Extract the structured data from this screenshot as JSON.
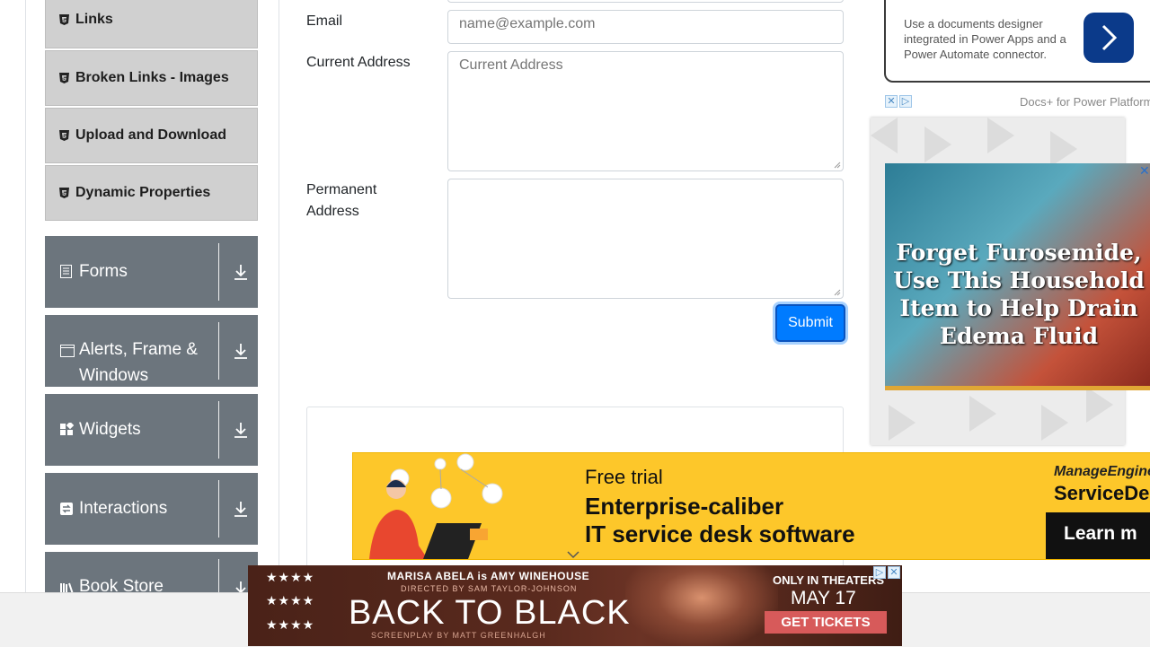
{
  "sidebar": {
    "elements_items": [
      {
        "label": "Links",
        "icon": "html5-icon"
      },
      {
        "label": "Broken Links - Images",
        "icon": "html5-icon"
      },
      {
        "label": "Upload and Download",
        "icon": "html5-icon"
      },
      {
        "label": "Dynamic Properties",
        "icon": "html5-icon"
      }
    ],
    "groups": [
      {
        "label": "Forms",
        "icon": "document-icon"
      },
      {
        "label": "Alerts, Frame & Windows",
        "icon": "window-icon"
      },
      {
        "label": "Widgets",
        "icon": "widgets-icon"
      },
      {
        "label": "Interactions",
        "icon": "interactions-icon"
      },
      {
        "label": "Book Store",
        "icon": "bookstore-icon"
      }
    ]
  },
  "form": {
    "email_label": "Email",
    "email_placeholder": "name@example.com",
    "email_value": "",
    "current_address_label": "Current Address",
    "current_address_placeholder": "Current Address",
    "permanent_address_label": "Permanent Address",
    "permanent_address_placeholder": "",
    "submit_label": "Submit"
  },
  "ads": {
    "docs_card_text": "Use a documents designer integrated in Power Apps and a Power Automate connector.",
    "docs_source": "Docs+ for Power Platform",
    "edema_headline": "Forget Furosemide, Use This Household Item to Help Drain Edema Fluid",
    "servicedesk": {
      "line1": "Free trial",
      "line2": "Enterprise-caliber",
      "line3": "IT service desk software",
      "brand1": "ManageEngine",
      "brand2": "ServiceDe",
      "cta": "Learn m"
    },
    "movie": {
      "stars": "★★★★",
      "cast": "MARISA ABELA is AMY WINEHOUSE",
      "director": "DIRECTED BY SAM TAYLOR-JOHNSON",
      "title": "BACK TO BLACK",
      "screenplay": "SCREENPLAY BY MATT GREENHALGH",
      "only_in_theaters": "ONLY IN THEATERS",
      "date": "MAY 17",
      "cta": "GET TICKETS"
    }
  },
  "colors": {
    "primary_button": "#007bff",
    "sidebar_group": "#6c757d",
    "sidebar_subitem": "#d0d0d0",
    "ad_yellow": "#fdc72a"
  }
}
